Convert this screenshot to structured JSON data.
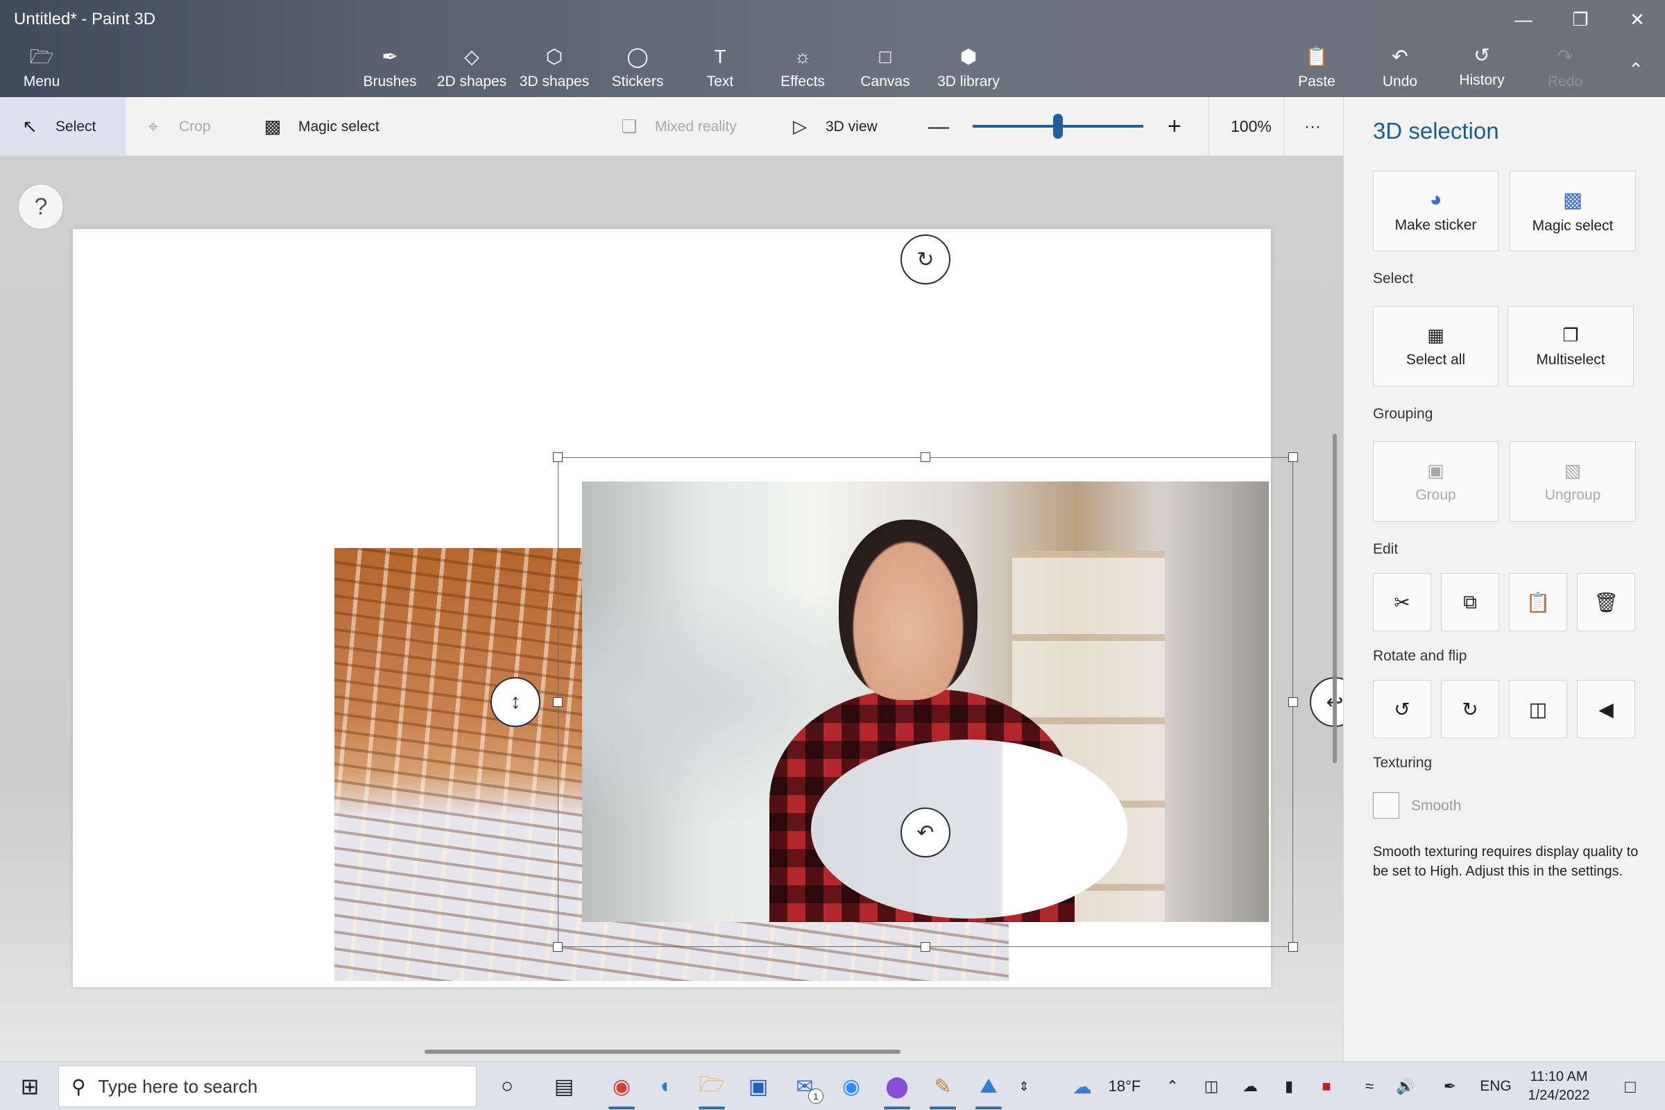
{
  "window": {
    "title": "Untitled* - Paint 3D",
    "minimize_icon": "minimize-icon",
    "restore_icon": "restore-icon",
    "close_icon": "close-icon"
  },
  "ribbon": {
    "menu": "Menu",
    "brushes": "Brushes",
    "shapes_2d": "2D shapes",
    "shapes_3d": "3D shapes",
    "stickers": "Stickers",
    "text": "Text",
    "effects": "Effects",
    "canvas": "Canvas",
    "library_3d": "3D library",
    "paste": "Paste",
    "undo": "Undo",
    "history": "History",
    "redo": "Redo"
  },
  "toolbar": {
    "select": "Select",
    "crop": "Crop",
    "magic_select": "Magic select",
    "mixed_reality": "Mixed reality",
    "view_3d": "3D view",
    "zoom_value": "100%",
    "zoom_level_fraction": 0.5,
    "more": "···"
  },
  "workspace": {
    "help": "?"
  },
  "panel": {
    "title": "3D selection",
    "make_sticker": "Make sticker",
    "magic_select": "Magic select",
    "select_section": "Select",
    "select_all": "Select all",
    "multiselect": "Multiselect",
    "grouping_section": "Grouping",
    "group": "Group",
    "ungroup": "Ungroup",
    "edit_section": "Edit",
    "rotate_section": "Rotate and flip",
    "texturing_section": "Texturing",
    "smooth": "Smooth",
    "smooth_note": "Smooth texturing requires display quality to be set to High. Adjust this in the settings."
  },
  "taskbar": {
    "search_placeholder": "Type here to search",
    "temperature": "18°F",
    "language": "ENG",
    "time": "11:10 AM",
    "date": "1/24/2022",
    "mail_badge": "1",
    "accent": "#2f6fb3"
  }
}
